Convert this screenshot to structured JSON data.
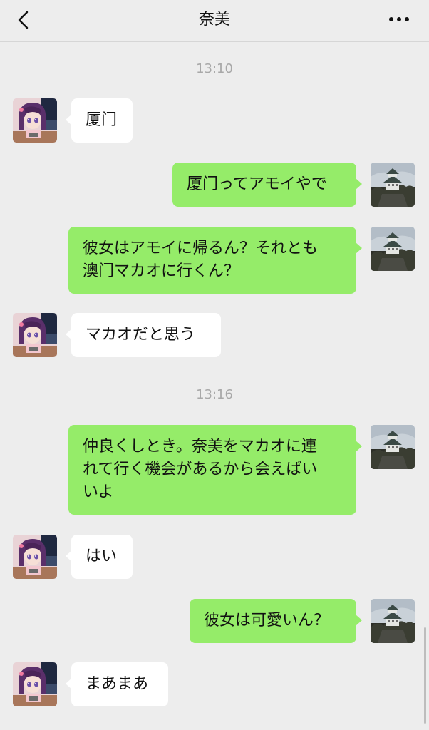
{
  "header": {
    "title": "奈美",
    "back_icon": "chevron-left-icon",
    "more_icon": "more-horizontal-icon"
  },
  "colors": {
    "background": "#ededed",
    "incoming_bubble": "#ffffff",
    "outgoing_bubble": "#95ec69",
    "timestamp": "#a8a8a8"
  },
  "messages": [
    {
      "type": "timestamp",
      "text": "13:10"
    },
    {
      "type": "incoming",
      "sender": "奈美",
      "lines": [
        "厦门"
      ]
    },
    {
      "type": "outgoing",
      "lines": [
        "厦门ってアモイやで"
      ]
    },
    {
      "type": "outgoing",
      "lines": [
        "彼女はアモイに帰るん？それとも",
        "澳门マカオに行くん？"
      ]
    },
    {
      "type": "incoming",
      "sender": "奈美",
      "lines": [
        "マカオだと思う"
      ]
    },
    {
      "type": "timestamp",
      "text": "13:16"
    },
    {
      "type": "outgoing",
      "lines": [
        "仲良くしとき。奈美をマカオに連",
        "れて行く機会があるから会えばい",
        "いよ"
      ]
    },
    {
      "type": "incoming",
      "sender": "奈美",
      "lines": [
        "はい"
      ]
    },
    {
      "type": "outgoing",
      "lines": [
        "彼女は可愛いん？"
      ]
    },
    {
      "type": "incoming",
      "sender": "奈美",
      "lines": [
        "まあまあ"
      ]
    }
  ]
}
